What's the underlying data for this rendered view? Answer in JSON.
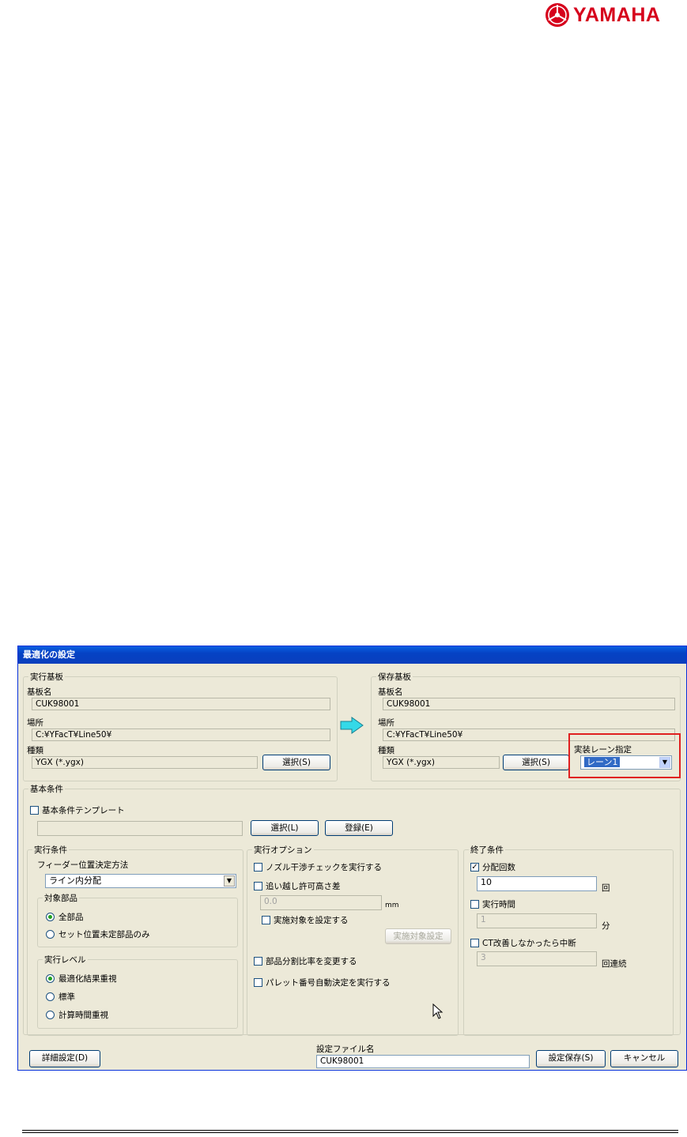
{
  "logo": {
    "text": "YAMAHA"
  },
  "dialog": {
    "title": "最適化の設定",
    "exec_board": {
      "legend": "実行基板",
      "name_label": "基板名",
      "name_value": "CUK98001",
      "loc_label": "場所",
      "loc_value": "C:¥YFacT¥Line50¥",
      "type_label": "種類",
      "type_value": "YGX (*.ygx)",
      "select_btn": "選択(S)"
    },
    "save_board": {
      "legend": "保存基板",
      "name_label": "基板名",
      "name_value": "CUK98001",
      "loc_label": "場所",
      "loc_value": "C:¥YFacT¥Line50¥",
      "type_label": "種類",
      "type_value": "YGX (*.ygx)",
      "select_btn": "選択(S)",
      "lane_label": "実装レーン指定",
      "lane_value": "レーン1"
    },
    "basic": {
      "legend": "基本条件",
      "template_label": "基本条件テンプレート",
      "select_btn": "選択(L)",
      "register_btn": "登録(E)",
      "exec_cond": {
        "legend": "実行条件",
        "feeder_label": "フィーダー位置決定方法",
        "feeder_value": "ライン内分配",
        "target_legend": "対象部品",
        "target_opt1": "全部品",
        "target_opt2": "セット位置未定部品のみ",
        "level_legend": "実行レベル",
        "level_opt1": "最適化結果重視",
        "level_opt2": "標準",
        "level_opt3": "計算時間重視"
      },
      "exec_opt": {
        "legend": "実行オプション",
        "nozzle_check": "ノズル干渉チェックを実行する",
        "overtake_label": "追い越し許可高さ差",
        "overtake_value": "0.0",
        "overtake_unit": "mm",
        "target_setting_check": "実施対象を設定する",
        "target_setting_btn": "実施対象設定",
        "ratio_check": "部品分割比率を変更する",
        "pallet_check": "パレット番号自動決定を実行する"
      },
      "end_cond": {
        "legend": "終了条件",
        "dist_label": "分配回数",
        "dist_value": "10",
        "dist_unit": "回",
        "time_label": "実行時間",
        "time_value": "1",
        "time_unit": "分",
        "ct_label": "CT改善しなかったら中断",
        "ct_value": "3",
        "ct_unit": "回連続"
      }
    },
    "footer": {
      "detail_btn": "詳細設定(D)",
      "file_label": "設定ファイル名",
      "file_value": "CUK98001",
      "save_btn": "設定保存(S)",
      "cancel_btn": "キャンセル"
    }
  }
}
